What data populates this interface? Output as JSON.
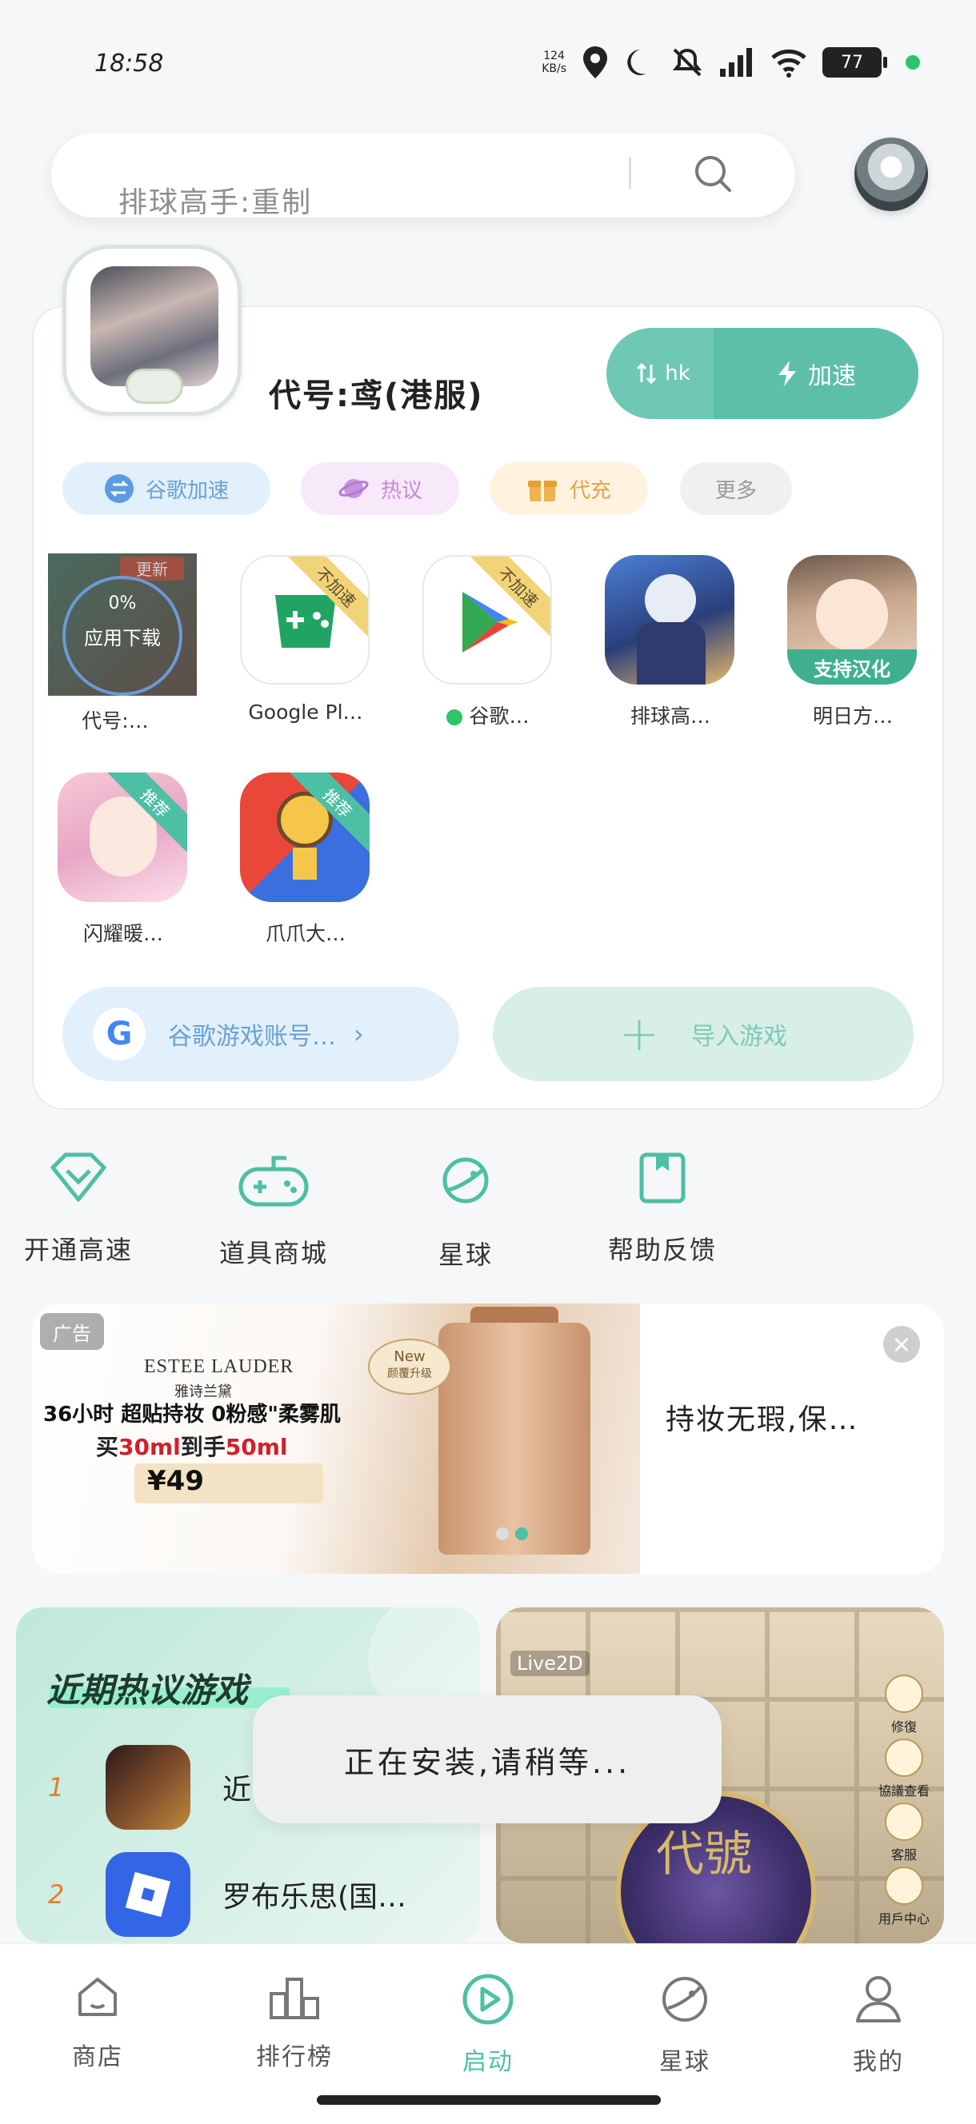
{
  "status_bar": {
    "time": "18:58",
    "speed_top": "124",
    "speed_bottom": "KB/s",
    "battery": "77"
  },
  "search": {
    "placeholder": "排球高手:重制"
  },
  "profile": {
    "name": "代号:鸢(港服)"
  },
  "accelerate": {
    "region": "hk",
    "label": "加速"
  },
  "chips": [
    {
      "label": "谷歌加速",
      "color": "#6aa0d4"
    },
    {
      "label": "热议",
      "color": "#c58ad6"
    },
    {
      "label": "代充",
      "color": "#e3a34a"
    },
    {
      "label": "更多",
      "color": "#999999"
    }
  ],
  "apps": [
    {
      "label": "代号:…",
      "overlay_top": "更新",
      "overlay_percent": "0%",
      "overlay_text": "应用下载"
    },
    {
      "label": "Google Pl…",
      "ribbon": "不加速"
    },
    {
      "label": "谷歌…",
      "ribbon": "不加速"
    },
    {
      "label": "排球高…"
    },
    {
      "label": "明日方…",
      "banner": "支持汉化"
    },
    {
      "label": "闪耀暖…",
      "ribbon": "推荐"
    },
    {
      "label": "爪爪大…",
      "ribbon": "推荐"
    }
  ],
  "google_account": {
    "label": "谷歌游戏账号…",
    "g": "G"
  },
  "import": {
    "label": "导入游戏"
  },
  "quick_nav": [
    {
      "label": "开通高速",
      "icon": "diamond-icon"
    },
    {
      "label": "道具商城",
      "icon": "gamepad-icon"
    },
    {
      "label": "星球",
      "icon": "planet-icon"
    },
    {
      "label": "帮助反馈",
      "icon": "bookmark-icon"
    }
  ],
  "ad": {
    "badge": "广告",
    "brand": "ESTEE LAUDER",
    "brand_cn": "雅诗兰黛",
    "line1": "36小时 超贴持妆 0粉感\"柔雾肌",
    "line2_a": "买",
    "line2_b": "30ml",
    "line2_c": "到手",
    "line2_d": "50ml",
    "price": "¥49",
    "new_badge_1": "New",
    "new_badge_2": "颜覆升级",
    "headline": "持妆无瑕,保…",
    "close": "×"
  },
  "hot_games": {
    "title": "近期热议游戏",
    "items": [
      {
        "rank": "1",
        "name": "近…"
      },
      {
        "rank": "2",
        "name": "罗布乐思(国…"
      }
    ]
  },
  "live_card": {
    "logo": "Live2D",
    "center_text": "代號",
    "side_items": [
      "修復",
      "協議查看",
      "客服",
      "用戶中心"
    ]
  },
  "toast": {
    "text": "正在安装,请稍等..."
  },
  "bottom_nav": [
    {
      "label": "商店",
      "icon": "store-icon"
    },
    {
      "label": "排行榜",
      "icon": "chart-icon"
    },
    {
      "label": "启动",
      "icon": "play-icon",
      "active": true
    },
    {
      "label": "星球",
      "icon": "planet-icon"
    },
    {
      "label": "我的",
      "icon": "user-icon"
    }
  ],
  "colors": {
    "accent": "#4dbfa4",
    "accent_light": "#6fc8b4",
    "background": "#f5f7f8"
  }
}
